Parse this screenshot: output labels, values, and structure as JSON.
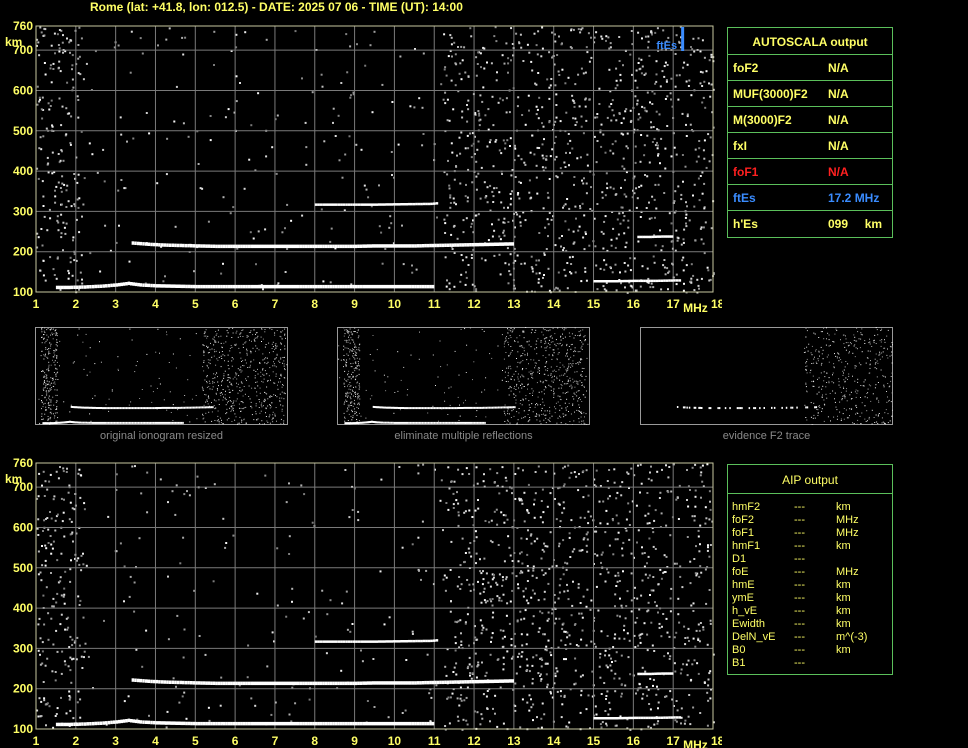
{
  "header": "Rome (lat: +41.8, lon: 012.5) - DATE: 2025 07 06 - TIME (UT): 14:00",
  "colors": {
    "text": "#ffff66",
    "grid": "#7a7a7a",
    "border": "#5bbf5b",
    "ftEs": "#3a8cff",
    "foF1": "#ff2020",
    "trace": "#ffffff"
  },
  "chart_data": [
    {
      "type": "scatter",
      "name": "ionogram-top",
      "xlabel": "MHz",
      "ylabel": "km",
      "xlim": [
        1,
        18
      ],
      "ylim": [
        100,
        760
      ],
      "x_ticks": [
        1,
        2,
        3,
        4,
        5,
        6,
        7,
        8,
        9,
        10,
        11,
        12,
        13,
        14,
        15,
        16,
        17,
        18
      ],
      "y_ticks": [
        100,
        200,
        300,
        400,
        500,
        600,
        700,
        760
      ],
      "grid": true,
      "traces": [
        {
          "x": [
            1.5,
            1.8,
            2.2,
            2.6,
            3.0,
            3.3,
            3.6,
            4.0,
            4.5,
            5.0,
            5.5,
            6.0,
            6.5,
            7.0,
            7.5,
            8.0,
            8.5,
            9.0,
            9.5,
            10.0,
            10.5,
            11.0
          ],
          "y": [
            112,
            112,
            113,
            115,
            118,
            122,
            118,
            116,
            115,
            114,
            114,
            114,
            114,
            114,
            114,
            114,
            114,
            114,
            114,
            114,
            114,
            114
          ]
        },
        {
          "x": [
            3.4,
            3.8,
            4.2,
            4.6,
            5.0,
            5.5,
            6.0,
            6.5,
            7.0,
            7.5,
            8.0,
            8.5,
            9.0,
            9.5,
            10.0,
            10.5,
            11.0,
            11.5,
            12.0,
            12.5,
            13.0
          ],
          "y": [
            222,
            219,
            217,
            216,
            215,
            214,
            214,
            214,
            214,
            214,
            214,
            214,
            214,
            215,
            215,
            215,
            216,
            217,
            218,
            219,
            220
          ]
        },
        {
          "x": [
            15.0,
            15.5,
            16.0,
            16.5,
            17.0,
            17.2
          ],
          "y": [
            126,
            126,
            127,
            127,
            128,
            128
          ]
        },
        {
          "x": [
            16.1,
            16.4,
            16.7,
            17.0
          ],
          "y": [
            236,
            236,
            237,
            237
          ]
        },
        {
          "x": [
            8.0,
            9.4,
            10.9,
            11.1
          ],
          "y": [
            316,
            316,
            318,
            320
          ]
        }
      ],
      "ftEs_label": "ftEs",
      "ftEs_mhz": 17.2
    },
    {
      "type": "scatter",
      "name": "ionogram-bottom",
      "xlabel": "MHz",
      "ylabel": "km",
      "xlim": [
        1,
        18
      ],
      "ylim": [
        100,
        760
      ],
      "x_ticks": [
        1,
        2,
        3,
        4,
        5,
        6,
        7,
        8,
        9,
        10,
        11,
        12,
        13,
        14,
        15,
        16,
        17,
        18
      ],
      "y_ticks": [
        100,
        200,
        300,
        400,
        500,
        600,
        700,
        760
      ],
      "grid": true,
      "traces": [
        {
          "x": [
            1.5,
            1.8,
            2.2,
            2.6,
            3.0,
            3.3,
            3.6,
            4.0,
            4.5,
            5.0,
            5.5,
            6.0,
            6.5,
            7.0,
            7.5,
            8.0,
            8.5,
            9.0,
            9.5,
            10.0,
            10.5,
            11.0
          ],
          "y": [
            112,
            112,
            113,
            115,
            118,
            122,
            118,
            116,
            115,
            114,
            114,
            114,
            114,
            114,
            114,
            114,
            114,
            114,
            114,
            114,
            114,
            114
          ]
        },
        {
          "x": [
            3.4,
            3.8,
            4.2,
            4.6,
            5.0,
            5.5,
            6.0,
            6.5,
            7.0,
            7.5,
            8.0,
            8.5,
            9.0,
            9.5,
            10.0,
            10.5,
            11.0,
            11.5,
            12.0,
            12.5,
            13.0
          ],
          "y": [
            222,
            219,
            217,
            216,
            215,
            214,
            214,
            214,
            214,
            214,
            214,
            214,
            214,
            215,
            215,
            215,
            216,
            217,
            218,
            219,
            220
          ]
        },
        {
          "x": [
            15.0,
            15.5,
            16.0,
            16.5,
            17.0,
            17.2
          ],
          "y": [
            126,
            126,
            127,
            127,
            128,
            128
          ]
        },
        {
          "x": [
            16.1,
            16.4,
            16.7,
            17.0
          ],
          "y": [
            236,
            236,
            237,
            237
          ]
        },
        {
          "x": [
            8.0,
            9.4,
            10.9,
            11.1
          ],
          "y": [
            316,
            316,
            318,
            320
          ]
        }
      ]
    }
  ],
  "thumbnails": [
    {
      "caption": "original ionogram resized"
    },
    {
      "caption": "eliminate multiple reflections"
    },
    {
      "caption": "evidence F2 trace"
    }
  ],
  "autoscala": {
    "title": "AUTOSCALA output",
    "rows": [
      {
        "label": "foF2",
        "value": "N/A",
        "color": "#ffff66"
      },
      {
        "label": "MUF(3000)F2",
        "value": "N/A",
        "color": "#ffff66"
      },
      {
        "label": "M(3000)F2",
        "value": "N/A",
        "color": "#ffff66"
      },
      {
        "label": "fxI",
        "value": "N/A",
        "color": "#ffff66"
      },
      {
        "label": "foF1",
        "value": "N/A",
        "color": "#ff2020"
      },
      {
        "label": "ftEs",
        "value": "17.2 MHz",
        "color": "#3a8cff"
      },
      {
        "label": "h'Es",
        "value": "099     km",
        "color": "#ffff66"
      }
    ]
  },
  "aip": {
    "title": "AIP output",
    "rows": [
      {
        "label": "hmF2",
        "value": "---",
        "unit": "km"
      },
      {
        "label": "foF2",
        "value": "---",
        "unit": "MHz"
      },
      {
        "label": "foF1",
        "value": "---",
        "unit": "MHz"
      },
      {
        "label": "hmF1",
        "value": "---",
        "unit": "km"
      },
      {
        "label": "D1",
        "value": "---",
        "unit": ""
      },
      {
        "label": "foE",
        "value": "---",
        "unit": "MHz"
      },
      {
        "label": "hmE",
        "value": "---",
        "unit": "km"
      },
      {
        "label": "ymE",
        "value": "---",
        "unit": "km"
      },
      {
        "label": "h_vE",
        "value": "---",
        "unit": "km"
      },
      {
        "label": "Ewidth",
        "value": "---",
        "unit": "km"
      },
      {
        "label": "DelN_vE",
        "value": "---",
        "unit": "m^(-3)"
      },
      {
        "label": "B0",
        "value": "---",
        "unit": "km"
      },
      {
        "label": "B1",
        "value": "---",
        "unit": ""
      }
    ]
  }
}
